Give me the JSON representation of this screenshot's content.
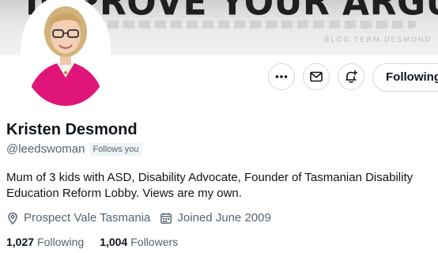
{
  "banner": {
    "headline": "IMPROVE YOUR ARGUMENT.",
    "credit": "BLOG.TERM.DESMOND"
  },
  "profile": {
    "name": "Kristen Desmond",
    "handle": "@leedswoman",
    "follows_you_label": "Follows you",
    "bio": "Mum of 3 kids with ASD, Disability Advocate, Founder of Tasmanian Disability Education Reform Lobby. Views are my own.",
    "location": "Prospect Vale Tasmania",
    "joined": "Joined June 2009",
    "following_count": "1,027",
    "following_label": "Following",
    "followers_count": "1,004",
    "followers_label": "Followers"
  },
  "actions": {
    "more_icon": "more-horizontal-icon",
    "message_icon": "envelope-icon",
    "notify_icon": "bell-plus-icon",
    "following_button_label": "Following"
  },
  "colors": {
    "text_primary": "#0f1419",
    "text_secondary": "#536471",
    "border": "#cfd9de",
    "avatar_jacket": "#e0157a"
  }
}
